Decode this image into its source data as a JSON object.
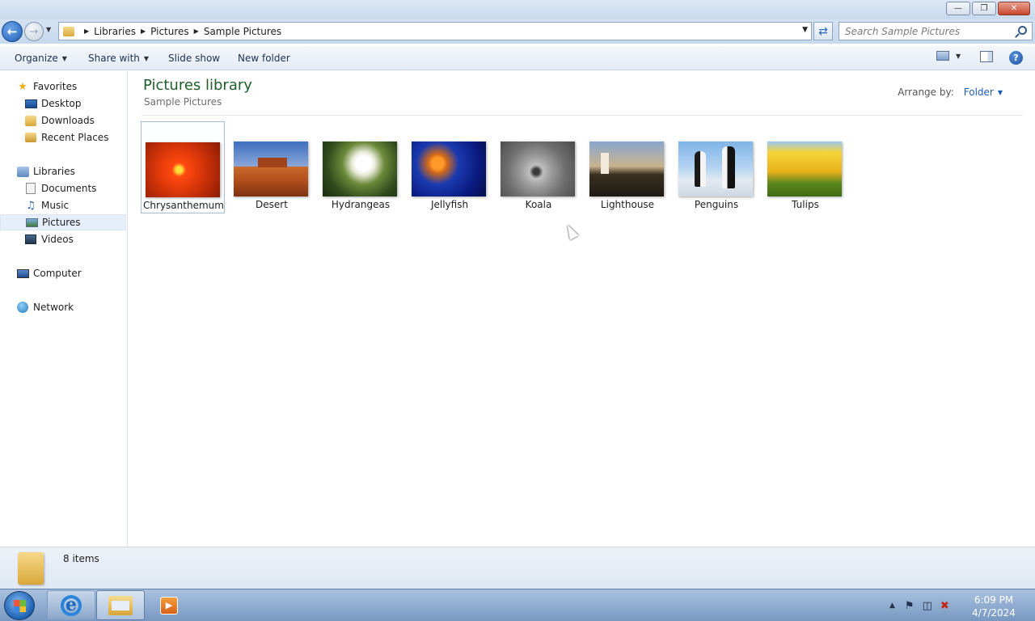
{
  "window": {
    "minimize_icon": "minimize-icon",
    "maximize_icon": "restore-icon",
    "close_icon": "close-icon"
  },
  "address": {
    "breadcrumbs": [
      "Libraries",
      "Pictures",
      "Sample Pictures"
    ],
    "search_placeholder": "Search Sample Pictures"
  },
  "toolbar": {
    "organize": "Organize",
    "share_with": "Share with",
    "slide_show": "Slide show",
    "new_folder": "New folder"
  },
  "sidebar": {
    "favorites": {
      "label": "Favorites",
      "items": [
        "Desktop",
        "Downloads",
        "Recent Places"
      ]
    },
    "libraries": {
      "label": "Libraries",
      "items": [
        "Documents",
        "Music",
        "Pictures",
        "Videos"
      ],
      "selected": "Pictures"
    },
    "computer": "Computer",
    "network": "Network"
  },
  "content": {
    "title": "Pictures library",
    "subtitle": "Sample Pictures",
    "arrange_label": "Arrange by:",
    "arrange_value": "Folder",
    "items": [
      {
        "name": "Chrysanthemum",
        "selected": true
      },
      {
        "name": "Desert"
      },
      {
        "name": "Hydrangeas"
      },
      {
        "name": "Jellyfish"
      },
      {
        "name": "Koala"
      },
      {
        "name": "Lighthouse"
      },
      {
        "name": "Penguins"
      },
      {
        "name": "Tulips"
      }
    ]
  },
  "status": {
    "count": "8 items"
  },
  "taskbar": {
    "time": "6:09 PM",
    "date": "4/7/2024"
  }
}
